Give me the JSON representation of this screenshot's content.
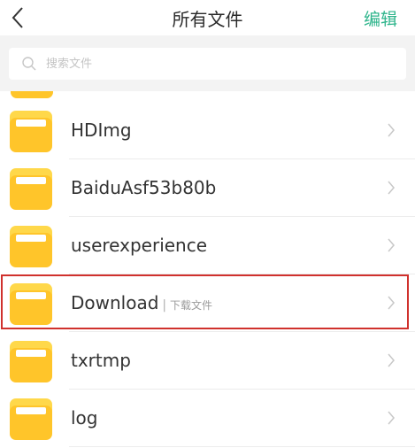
{
  "header": {
    "title": "所有文件",
    "edit_label": "编辑",
    "accent_color": "#2fb58c"
  },
  "search": {
    "placeholder": "搜索文件"
  },
  "files": [
    {
      "name": "HDImg",
      "tag": ""
    },
    {
      "name": "BaiduAsf53b80b",
      "tag": ""
    },
    {
      "name": "userexperience",
      "tag": ""
    },
    {
      "name": "Download",
      "tag": "下载文件",
      "highlighted": true
    },
    {
      "name": "txrtmp",
      "tag": ""
    },
    {
      "name": "log",
      "tag": ""
    }
  ],
  "icons": {
    "back": "chevron-left-icon",
    "search": "search-icon",
    "folder": "folder-icon",
    "row_arrow": "chevron-right-icon"
  },
  "colors": {
    "folder": "#ffc52a",
    "highlight_border": "#d0312d"
  }
}
